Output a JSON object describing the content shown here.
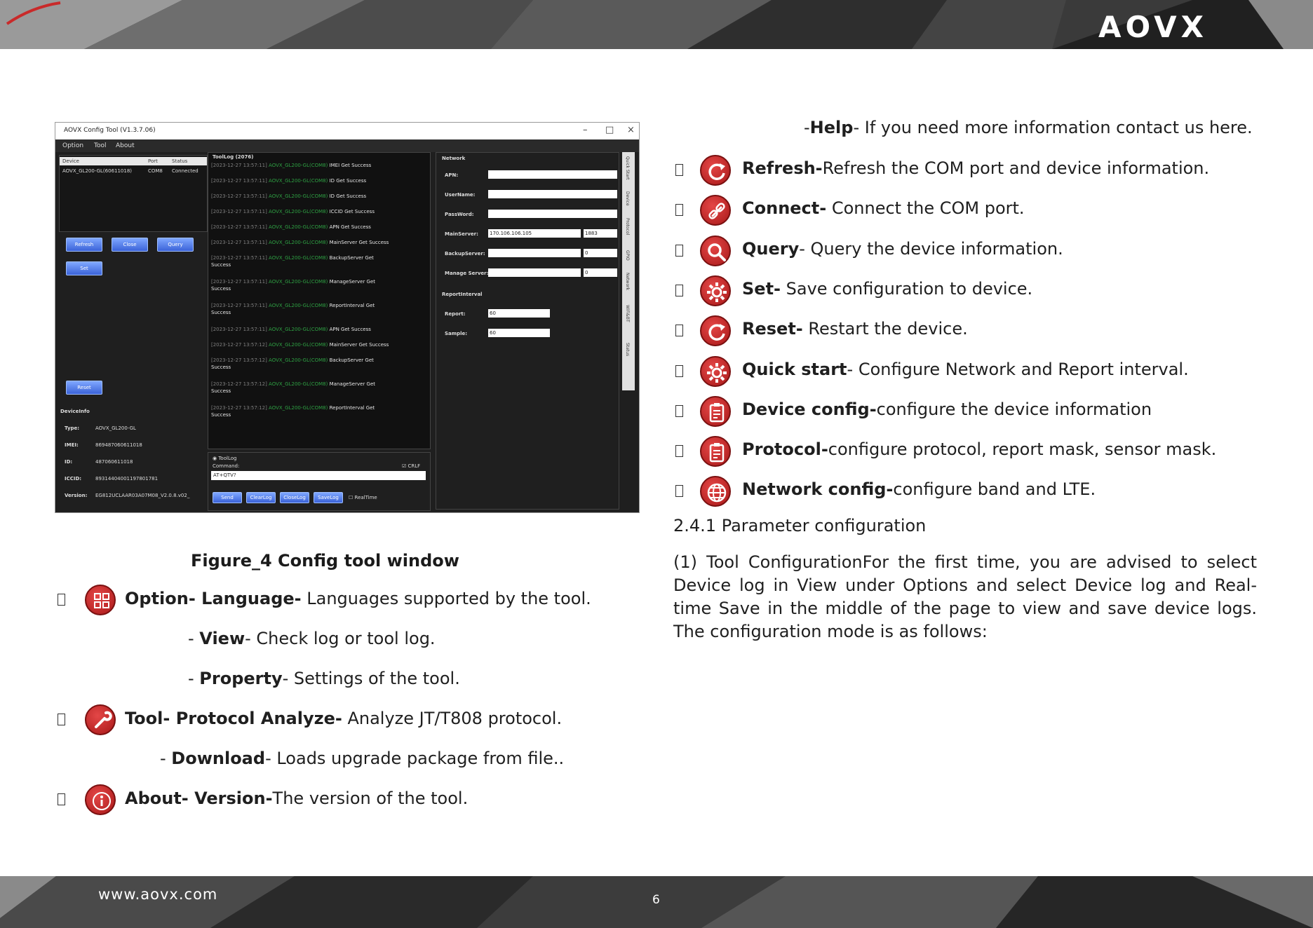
{
  "header": {
    "logo": "AOVX"
  },
  "footer": {
    "website": "www.aovx.com",
    "page_number": "6"
  },
  "figure": {
    "caption": "Figure_4 Config tool window",
    "window_title": "AOVX Config Tool (V1.3.7.06)",
    "menu": [
      "Option",
      "Tool",
      "About"
    ],
    "device_table": {
      "headers": [
        "Device",
        "Port",
        "Status"
      ],
      "row": [
        "AOVX_GL200-GL(60611018)",
        "COM8",
        "Connected"
      ]
    },
    "buttons": {
      "refresh": "Refresh",
      "close": "Close",
      "query": "Query",
      "set": "Set",
      "reset": "Reset"
    },
    "device_info": {
      "title": "DeviceInfo",
      "labels": [
        "Type:",
        "IMEI:",
        "ID:",
        "ICCID:",
        "Version:"
      ],
      "values": [
        "AOVX_GL200-GL",
        "869487060611018",
        "487060611018",
        "89314404001197801781",
        "EG812UCLAAR03A07M08_V2.0.8.v02_"
      ]
    },
    "tool_log": {
      "title": "ToolLog (2076)",
      "lines": [
        {
          "ts": "[2023-12-27 13:57:11]",
          "dev": "AOVX_GL200-GL(COM8)",
          "msg": "IMEI Get Success",
          "cont": ""
        },
        {
          "ts": "[2023-12-27 13:57:11]",
          "dev": "AOVX_GL200-GL(COM8)",
          "msg": "ID Get Success",
          "cont": ""
        },
        {
          "ts": "[2023-12-27 13:57:11]",
          "dev": "AOVX_GL200-GL(COM8)",
          "msg": "ID Get Success",
          "cont": ""
        },
        {
          "ts": "[2023-12-27 13:57:11]",
          "dev": "AOVX_GL200-GL(COM8)",
          "msg": "ICCID Get Success",
          "cont": ""
        },
        {
          "ts": "[2023-12-27 13:57:11]",
          "dev": "AOVX_GL200-GL(COM8)",
          "msg": "APN Get Success",
          "cont": ""
        },
        {
          "ts": "[2023-12-27 13:57:11]",
          "dev": "AOVX_GL200-GL(COM8)",
          "msg": "MainServer Get Success",
          "cont": ""
        },
        {
          "ts": "[2023-12-27 13:57:11]",
          "dev": "AOVX_GL200-GL(COM8)",
          "msg": "BackupServer Get",
          "cont": "Success"
        },
        {
          "ts": "[2023-12-27 13:57:11]",
          "dev": "AOVX_GL200-GL(COM8)",
          "msg": "ManageServer Get",
          "cont": "Success"
        },
        {
          "ts": "[2023-12-27 13:57:11]",
          "dev": "AOVX_GL200-GL(COM8)",
          "msg": "ReportInterval Get",
          "cont": "Success"
        },
        {
          "ts": "[2023-12-27 13:57:11]",
          "dev": "AOVX_GL200-GL(COM8)",
          "msg": "APN Get Success",
          "cont": ""
        },
        {
          "ts": "[2023-12-27 13:57:12]",
          "dev": "AOVX_GL200-GL(COM8)",
          "msg": "MainServer Get Success",
          "cont": ""
        },
        {
          "ts": "[2023-12-27 13:57:12]",
          "dev": "AOVX_GL200-GL(COM8)",
          "msg": "BackupServer Get",
          "cont": "Success"
        },
        {
          "ts": "[2023-12-27 13:57:12]",
          "dev": "AOVX_GL200-GL(COM8)",
          "msg": "ManageServer Get",
          "cont": "Success"
        },
        {
          "ts": "[2023-12-27 13:57:12]",
          "dev": "AOVX_GL200-GL(COM8)",
          "msg": "ReportInterval Get",
          "cont": "Success"
        }
      ]
    },
    "command": {
      "toollog_radio": "ToolLog",
      "label": "Command:",
      "crlf": "CRLF",
      "value": "AT+QTV?",
      "buttons": [
        "Send",
        "ClearLog",
        "CloseLog",
        "SaveLog"
      ],
      "realtime": "RealTime"
    },
    "network": {
      "title": "Network",
      "apn": "APN:",
      "username": "UserName:",
      "password": "PassWord:",
      "mainserver": "MainServer:",
      "mainserver_ip": "170.106.106.105",
      "mainserver_port": "1883",
      "backupserver": "BackupServer:",
      "backup_port": "0",
      "manageserver": "Manage Server:",
      "manage_port": "0",
      "report_title": "ReportInterval",
      "report": "Report:",
      "report_val": "60",
      "sample": "Sample:",
      "sample_val": "60"
    },
    "side_tabs": [
      "Quick Start",
      "Device",
      "Protocol",
      "GPIO",
      "Network",
      "WiFi&BT",
      "Status"
    ]
  },
  "left_items": [
    {
      "bold": "Option- Language-",
      "rest": " Languages supported by the tool.",
      "icon": "option-grid-icon"
    },
    {
      "prefix": "- ",
      "bold": "View",
      "rest": "- Check log or tool log."
    },
    {
      "prefix": "- ",
      "bold": "Property",
      "rest": "- Settings of the tool."
    },
    {
      "bold": "Tool- Protocol Analyze-",
      "rest": " Analyze JT/T808 protocol.",
      "icon": "wrench-icon"
    },
    {
      "prefix": "- ",
      "bold": "Download",
      "rest": "- Loads upgrade package from file.."
    },
    {
      "bold": "About- Version-",
      "rest": "The version of the tool.",
      "icon": "info-icon"
    }
  ],
  "right_items": [
    {
      "prefix": "-",
      "bold": "Help",
      "rest": "- If you need more information contact us here."
    },
    {
      "bold": "Refresh-",
      "rest": "Refresh the COM port and device information.",
      "icon": "refresh-icon"
    },
    {
      "bold": "Connect-",
      "rest": " Connect the COM port.",
      "icon": "link-icon"
    },
    {
      "bold": "Query",
      "rest": "- Query the device information.",
      "icon": "magnifier-icon"
    },
    {
      "bold": "Set-",
      "rest": " Save configuration to device.",
      "icon": "gear-icon"
    },
    {
      "bold": "Reset-",
      "rest": " Restart the device.",
      "icon": "reset-icon"
    },
    {
      "bold": "Quick start",
      "rest": "- Configure Network and Report interval.",
      "icon": "gear-icon"
    },
    {
      "bold": "Device config-",
      "rest": "configure the device information",
      "icon": "clipboard-icon"
    },
    {
      "bold": "Protocol-",
      "rest": "configure protocol, report mask, sensor mask.",
      "icon": "clipboard-icon"
    },
    {
      "bold": "Network config-",
      "rest": "configure band and LTE.",
      "icon": "globe-icon"
    }
  ],
  "section_heading": "2.4.1 Parameter configuration",
  "paragraph": "(1) Tool ConfigurationFor the first time, you are advised to select Device log in View under Options and select Device log and Real-time Save in the middle of the page to view and save device logs. The configuration mode is as follows:"
}
